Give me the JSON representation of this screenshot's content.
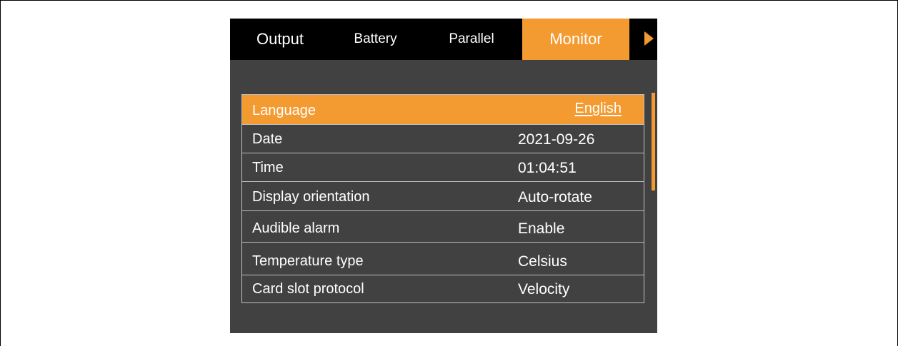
{
  "tabs": [
    {
      "label": "Output"
    },
    {
      "label": "Battery"
    },
    {
      "label": "Parallel"
    },
    {
      "label": "Monitor"
    }
  ],
  "settings": [
    {
      "label": "Language",
      "value": "English"
    },
    {
      "label": "Date",
      "value": "2021-09-26"
    },
    {
      "label": "Time",
      "value": "01:04:51"
    },
    {
      "label": "Display orientation",
      "value": "Auto-rotate"
    },
    {
      "label": "Audible alarm",
      "value": "Enable"
    },
    {
      "label": "Temperature type",
      "value": "Celsius"
    },
    {
      "label": "Card slot protocol",
      "value": "Velocity"
    }
  ],
  "colors": {
    "accent": "#f39b31",
    "panel": "#414141",
    "tabbar": "#000000",
    "divider": "#bfbfbf"
  },
  "icons": {
    "tab_next": "triangle-right-icon"
  }
}
